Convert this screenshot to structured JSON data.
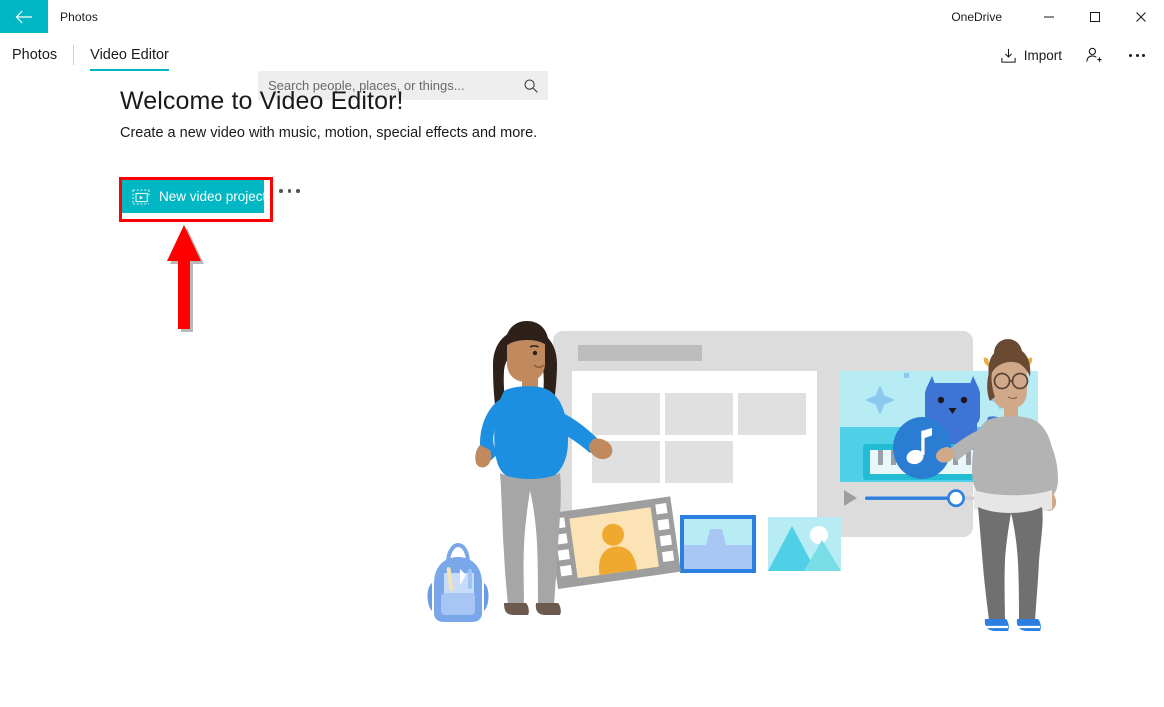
{
  "titlebar": {
    "back_icon": "back-arrow-icon",
    "app_title": "Photos",
    "account_label": "OneDrive",
    "minimize_icon": "minimize-icon",
    "maximize_icon": "maximize-icon",
    "close_icon": "close-icon",
    "accent_color": "#00b7c3"
  },
  "commandbar": {
    "tabs": [
      {
        "label": "Photos",
        "selected": false
      },
      {
        "label": "Video Editor",
        "selected": true
      }
    ],
    "search": {
      "placeholder": "Search people, places, or things...",
      "value": "",
      "icon": "search-icon"
    },
    "actions": [
      {
        "label": "Import",
        "icon": "import-icon"
      },
      {
        "label": "",
        "icon": "add-person-icon"
      },
      {
        "label": "",
        "icon": "more-horizontal-icon"
      }
    ]
  },
  "main": {
    "headline": "Welcome to Video Editor!",
    "subline": "Create a new video with music, motion, special effects and more.",
    "new_project_button": {
      "label": "New video project",
      "icon": "video-project-icon",
      "background": "#00b7c3",
      "text_color": "#ffffff"
    },
    "more_options_icon": "more-horizontal-icon",
    "highlight": {
      "color": "#ff0000",
      "target": "new-video-project-button"
    },
    "annotation_arrow": {
      "color": "#ff0000",
      "direction": "up",
      "points_to": "new-video-project-button"
    }
  },
  "illustration": {
    "name": "video-editor-hero-illustration",
    "description": "Two people standing beside a large video editor window with a cat-on-piano video preview, media thumbnails, a film strip and a music note badge",
    "colors": {
      "window_frame": "#dcdcdc",
      "panel_white": "#ffffff",
      "placeholder_gray": "#e0e0e0",
      "title_gray": "#bdbdbd",
      "preview_sky": "#b8ecf5",
      "preview_ground": "#4fd0e7",
      "cat_blue": "#3d74d6",
      "keyboard_teal": "#22bcd4",
      "scrub_blue": "#2a7fe0",
      "music_badge": "#2b7cd3",
      "shirt_blue": "#1d8fe0",
      "pants_gray": "#a6a6a6",
      "hair_dark": "#2e2119",
      "skin_left": "#c08a5e",
      "sweater_gray": "#b3b3b3",
      "pants_dark": "#707070",
      "hair_brown": "#6b4a33",
      "shoes_blue": "#2a7fe0",
      "film_gray": "#9e9e9e",
      "film_photo_bg": "#fbe3b6",
      "film_photo_figure": "#f0a92f",
      "thumb_selected_border": "#2a7fe0",
      "thumb_mountain_light": "#7ee0e0",
      "backpack_blue": "#7aa7ea"
    }
  }
}
